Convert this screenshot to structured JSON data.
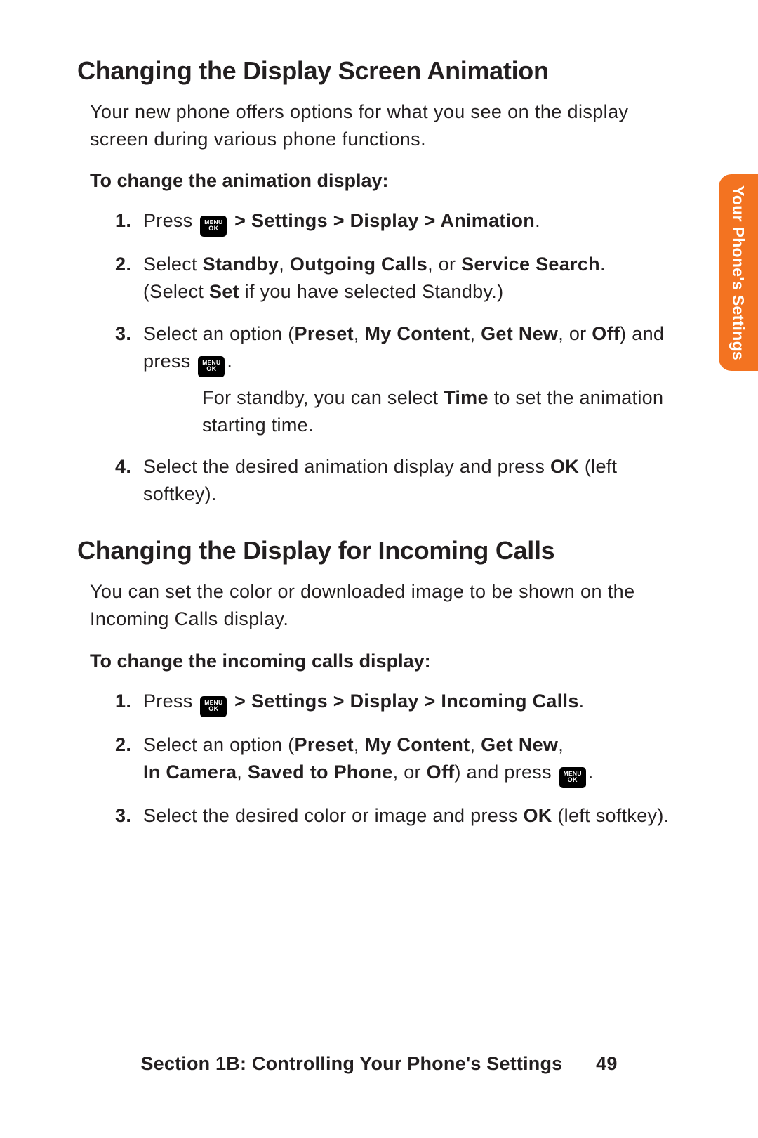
{
  "sideTab": "Your Phone's Settings",
  "menuIcon": {
    "top": "MENU",
    "bottom": "OK"
  },
  "section1": {
    "heading": "Changing the Display Screen Animation",
    "intro": "Your new phone offers options for what you see on the display screen during various phone functions.",
    "subHeading": "To change the animation display:",
    "steps": {
      "s1": {
        "num": "1.",
        "a": "Press ",
        "b_bold": " > Settings > Display > Animation",
        "c": "."
      },
      "s2": {
        "num": "2.",
        "a": "Select ",
        "b1": "Standby",
        "c1": ", ",
        "b2": "Outgoing Calls",
        "c2": ", or ",
        "b3": "Service Search",
        "c3": ".",
        "line2a": "(Select ",
        "line2b": "Set",
        "line2c": " if you have selected Standby.)"
      },
      "s3": {
        "num": "3.",
        "a": "Select an option (",
        "b1": "Preset",
        "c1": ", ",
        "b2": "My Content",
        "c2": ", ",
        "b3": "Get New",
        "c3": ", or ",
        "b4": "Off",
        "d": ") and press ",
        "e": ".",
        "noteA": "For standby, you can select ",
        "noteB": "Time",
        "noteC": " to set the animation starting time."
      },
      "s4": {
        "num": "4.",
        "a": "Select the desired animation display and press ",
        "b": "OK",
        "c": " (left softkey)."
      }
    }
  },
  "section2": {
    "heading": "Changing the Display for Incoming Calls",
    "intro": "You can set the color or downloaded image to be shown on the Incoming Calls display.",
    "subHeading": "To change the incoming calls display:",
    "steps": {
      "s1": {
        "num": "1.",
        "a": "Press ",
        "b_bold": " > Settings > Display > Incoming Calls",
        "c": "."
      },
      "s2": {
        "num": "2.",
        "a": "Select an option (",
        "b1": "Preset",
        "c1": ", ",
        "b2": "My Content",
        "c2": ", ",
        "b3": "Get New",
        "c3": ", ",
        "b4": "In Camera",
        "c4": ", ",
        "b5": "Saved to Phone",
        "c5": ", or ",
        "b6": "Off",
        "d": ") and press ",
        "e": "."
      },
      "s3": {
        "num": "3.",
        "a": "Select the desired color or image and press ",
        "b": "OK",
        "c": " (left softkey)."
      }
    }
  },
  "footer": {
    "section": "Section 1B: Controlling Your Phone's Settings",
    "page": "49"
  }
}
